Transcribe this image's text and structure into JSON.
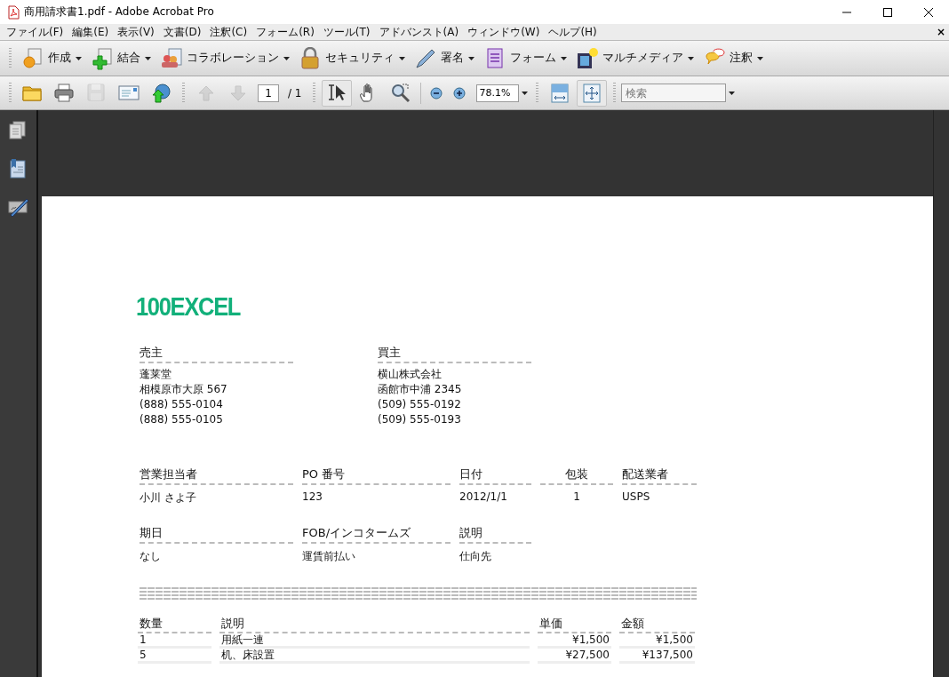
{
  "window": {
    "title": "商用請求書1.pdf - Adobe Acrobat Pro"
  },
  "menu": {
    "items": [
      "ファイル(F)",
      "編集(E)",
      "表示(V)",
      "文書(D)",
      "注釈(C)",
      "フォーム(R)",
      "ツール(T)",
      "アドバンスト(A)",
      "ウィンドウ(W)",
      "ヘルプ(H)"
    ],
    "close_document": "×"
  },
  "task_toolbar": [
    {
      "label": "作成"
    },
    {
      "label": "結合"
    },
    {
      "label": "コラボレーション"
    },
    {
      "label": "セキュリティ"
    },
    {
      "label": "署名"
    },
    {
      "label": "フォーム"
    },
    {
      "label": "マルチメディア"
    },
    {
      "label": "注釈"
    }
  ],
  "file_tools": [
    {
      "disabled": false
    },
    {
      "disabled": false
    },
    {
      "disabled": true
    },
    {
      "disabled": false
    },
    {
      "disabled": false
    }
  ],
  "page_nav": {
    "previous_disabled": true,
    "next_disabled": true,
    "page": "1",
    "total": "/ 1"
  },
  "view_tools": [
    {
      "selected": true
    },
    {
      "selected": false
    },
    {
      "selected": false
    }
  ],
  "zoom": {
    "value": "78.1%"
  },
  "fit_tools": [
    {
      "selected": false
    },
    {
      "selected": true
    }
  ],
  "search": {
    "placeholder": "検索"
  },
  "document": {
    "logo": "100EXCEL",
    "parties": [
      {
        "heading": "売主",
        "lines": [
          "蓬莱堂",
          "相模原市大原 567",
          "(888) 555-0104",
          "(888) 555-0105"
        ]
      },
      {
        "heading": "買主",
        "lines": [
          "横山株式会社",
          "函館市中浦 2345",
          "(509) 555-0192",
          "(509) 555-0193"
        ]
      }
    ],
    "field_rows": [
      [
        {
          "label": "営業担当者",
          "value": "小川 さよ子"
        },
        {
          "label": "PO 番号",
          "value": "123"
        },
        {
          "label": "日付",
          "value": "2012/1/1"
        },
        {
          "label": "包装",
          "value": "1"
        },
        {
          "label": "配送業者",
          "value": "USPS"
        }
      ],
      [
        {
          "label": "期日",
          "value": "なし"
        },
        {
          "label": "FOB/インコタームズ",
          "value": "運賃前払い"
        },
        {
          "label": "説明",
          "value": "仕向先"
        }
      ]
    ],
    "items": {
      "columns": [
        "数量",
        "説明",
        "単価",
        "金額"
      ],
      "rows": [
        [
          "1",
          "用紙一連",
          "¥1,500",
          "¥1,500"
        ],
        [
          "5",
          "机、床設置",
          "¥27,500",
          "¥137,500"
        ]
      ]
    }
  }
}
